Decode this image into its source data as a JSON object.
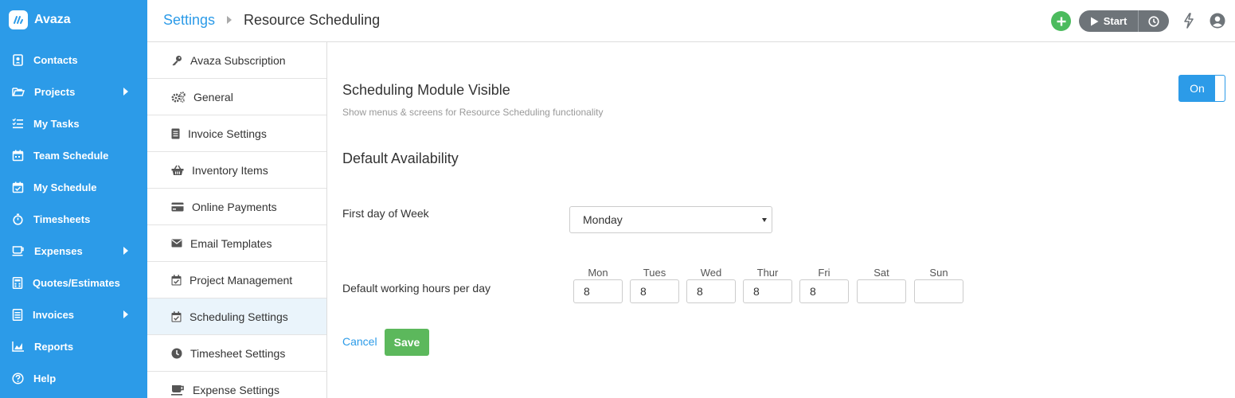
{
  "app": {
    "name": "Avaza"
  },
  "sidebar": {
    "items": [
      {
        "label": "Contacts",
        "icon": "contacts-icon"
      },
      {
        "label": "Projects",
        "icon": "folder-icon",
        "expandable": true
      },
      {
        "label": "My Tasks",
        "icon": "task-list-icon"
      },
      {
        "label": "Team Schedule",
        "icon": "calendar-icon"
      },
      {
        "label": "My Schedule",
        "icon": "calendar-check-icon"
      },
      {
        "label": "Timesheets",
        "icon": "stopwatch-icon"
      },
      {
        "label": "Expenses",
        "icon": "coffee-cup-icon",
        "expandable": true
      },
      {
        "label": "Quotes/Estimates",
        "icon": "calculator-icon"
      },
      {
        "label": "Invoices",
        "icon": "invoice-icon",
        "expandable": true
      },
      {
        "label": "Reports",
        "icon": "chart-icon"
      },
      {
        "label": "Help",
        "icon": "help-icon"
      }
    ]
  },
  "header": {
    "breadcrumb_root": "Settings",
    "breadcrumb_current": "Resource Scheduling",
    "timer_label": "Start"
  },
  "settings_menu": {
    "items": [
      {
        "label": "Avaza Subscription",
        "icon": "key-icon"
      },
      {
        "label": "General",
        "icon": "gears-icon"
      },
      {
        "label": "Invoice Settings",
        "icon": "document-icon"
      },
      {
        "label": "Inventory Items",
        "icon": "basket-icon"
      },
      {
        "label": "Online Payments",
        "icon": "credit-card-icon"
      },
      {
        "label": "Email Templates",
        "icon": "envelope-icon"
      },
      {
        "label": "Project Management",
        "icon": "calendar-check-icon"
      },
      {
        "label": "Scheduling Settings",
        "icon": "calendar-check-icon",
        "active": true
      },
      {
        "label": "Timesheet Settings",
        "icon": "clock-icon"
      },
      {
        "label": "Expense Settings",
        "icon": "coffee-cup-icon"
      }
    ]
  },
  "scheduling": {
    "module_title": "Scheduling Module Visible",
    "module_desc": "Show menus & screens for Resource Scheduling functionality",
    "toggle_label": "On",
    "availability_title": "Default Availability",
    "first_day_label": "First day of Week",
    "first_day_value": "Monday",
    "hours_label": "Default working hours per day",
    "days": [
      {
        "name": "Mon",
        "hours": "8"
      },
      {
        "name": "Tues",
        "hours": "8"
      },
      {
        "name": "Wed",
        "hours": "8"
      },
      {
        "name": "Thur",
        "hours": "8"
      },
      {
        "name": "Fri",
        "hours": "8"
      },
      {
        "name": "Sat",
        "hours": ""
      },
      {
        "name": "Sun",
        "hours": ""
      }
    ],
    "cancel_label": "Cancel",
    "save_label": "Save"
  },
  "colors": {
    "brand_blue": "#2c9be8",
    "add_green": "#4cbb5e",
    "save_green": "#5cb85c",
    "timer_gray": "#6e7479"
  }
}
